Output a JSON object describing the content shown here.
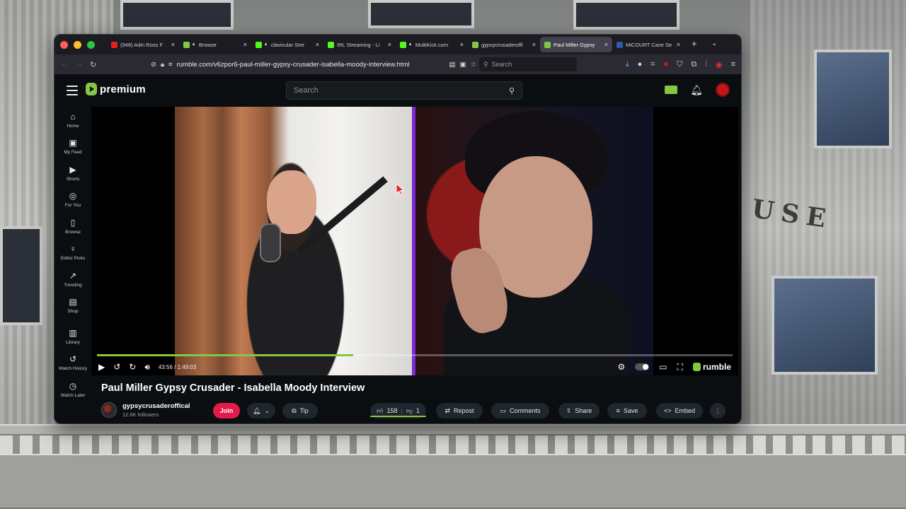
{
  "browser": {
    "tabs": [
      {
        "label": "(948) Adin Ross F",
        "fav_color": "#e62117",
        "muted": false
      },
      {
        "label": "Browse",
        "fav_color": "#85c742",
        "muted": true
      },
      {
        "label": "clavicular Stre",
        "fav_color": "#53fc18",
        "muted": true
      },
      {
        "label": "IRL Streaming - Li",
        "fav_color": "#53fc18",
        "muted": false
      },
      {
        "label": "MultiKick.com",
        "fav_color": "#53fc18",
        "muted": true
      },
      {
        "label": "gypsycrusaderoffi",
        "fav_color": "#85c742",
        "muted": false
      },
      {
        "label": "Paul Miller Gypsy",
        "fav_color": "#85c742",
        "muted": false,
        "active": true
      },
      {
        "label": "MiCOURT Case Se",
        "fav_color": "#2a5caa",
        "muted": false
      }
    ],
    "url": "rumble.com/v6zpor6-paul-miller-gypsy-crusader-isabella-moody-interview.html",
    "search_placeholder": "Search"
  },
  "site": {
    "logo_text": "premium",
    "search_placeholder": "Search",
    "sidebar": [
      {
        "label": "Home",
        "icon": "home-icon",
        "glyph": "⌂"
      },
      {
        "label": "My Feed",
        "icon": "feed-icon",
        "glyph": "▣"
      },
      {
        "label": "Shorts",
        "icon": "shorts-icon",
        "glyph": "▶"
      },
      {
        "label": "For You",
        "icon": "target-icon",
        "glyph": "◎"
      },
      {
        "label": "Browse",
        "icon": "browse-icon",
        "glyph": "▯"
      },
      {
        "label": "Editor Picks",
        "icon": "award-icon",
        "glyph": "♀"
      },
      {
        "label": "Trending",
        "icon": "trending-icon",
        "glyph": "↗"
      },
      {
        "label": "Shop",
        "icon": "shop-icon",
        "glyph": "▤"
      },
      {
        "label": "Library",
        "icon": "library-icon",
        "glyph": "▥"
      },
      {
        "label": "Watch History",
        "icon": "history-icon",
        "glyph": "↺"
      },
      {
        "label": "Watch Later",
        "icon": "clock-icon",
        "glyph": "◷"
      }
    ]
  },
  "player": {
    "time": "43:56 / 1:49:03",
    "progress": 0.403,
    "brand": "rumble"
  },
  "video": {
    "title": "Paul Miller Gypsy Crusader - Isabella Moody Interview",
    "channel": "gypsycrusaderoffical",
    "followers": "12.6K followers",
    "join_label": "Join",
    "tip_label": "Tip",
    "likes": "158",
    "dislikes": "1",
    "repost_label": "Repost",
    "comments_label": "Comments",
    "share_label": "Share",
    "save_label": "Save",
    "embed_label": "Embed"
  },
  "colors": {
    "accent": "#85c742",
    "join": "#e21b4b",
    "divider": "#7a2bd6"
  }
}
